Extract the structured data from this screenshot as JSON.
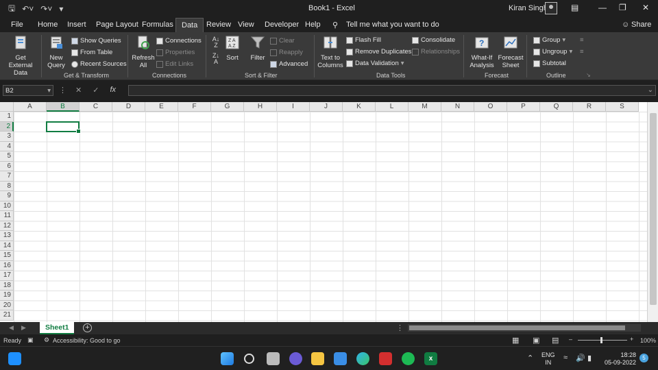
{
  "window": {
    "title": "Book1 - Excel",
    "user": "Kiran Singh"
  },
  "tabs": [
    {
      "label": "File"
    },
    {
      "label": "Home"
    },
    {
      "label": "Insert"
    },
    {
      "label": "Page Layout"
    },
    {
      "label": "Formulas"
    },
    {
      "label": "Data"
    },
    {
      "label": "Review"
    },
    {
      "label": "View"
    },
    {
      "label": "Developer"
    },
    {
      "label": "Help"
    }
  ],
  "tell_me": "Tell me what you want to do",
  "share": "Share",
  "ribbon": {
    "get_transform": {
      "label": "Get & Transform",
      "get_external_line1": "Get External",
      "get_external_line2": "Data",
      "new_query_line1": "New",
      "new_query_line2": "Query",
      "show_queries": "Show Queries",
      "from_table": "From Table",
      "recent_sources": "Recent Sources"
    },
    "connections": {
      "label": "Connections",
      "refresh_line1": "Refresh",
      "refresh_line2": "All",
      "connections": "Connections",
      "properties": "Properties",
      "edit_links": "Edit Links"
    },
    "sort_filter": {
      "label": "Sort & Filter",
      "sort": "Sort",
      "filter": "Filter",
      "clear": "Clear",
      "reapply": "Reapply",
      "advanced": "Advanced"
    },
    "data_tools": {
      "label": "Data Tools",
      "text_to_columns_line1": "Text to",
      "text_to_columns_line2": "Columns",
      "flash_fill": "Flash Fill",
      "remove_duplicates": "Remove Duplicates",
      "data_validation": "Data Validation",
      "consolidate": "Consolidate",
      "relationships": "Relationships"
    },
    "forecast": {
      "label": "Forecast",
      "whatif_line1": "What-If",
      "whatif_line2": "Analysis",
      "forecast_sheet_line1": "Forecast",
      "forecast_sheet_line2": "Sheet"
    },
    "outline": {
      "label": "Outline",
      "group": "Group",
      "ungroup": "Ungroup",
      "subtotal": "Subtotal"
    }
  },
  "formula_bar": {
    "name_box": "B2",
    "fx": "fx",
    "formula": ""
  },
  "grid": {
    "columns": [
      "A",
      "B",
      "C",
      "D",
      "E",
      "F",
      "G",
      "H",
      "I",
      "J",
      "K",
      "L",
      "M",
      "N",
      "O",
      "P",
      "Q",
      "R",
      "S"
    ],
    "rows": [
      "1",
      "2",
      "3",
      "4",
      "5",
      "6",
      "7",
      "8",
      "9",
      "10",
      "11",
      "12",
      "13",
      "14",
      "15",
      "16",
      "17",
      "18",
      "19",
      "20",
      "21"
    ],
    "selected_cell": "B2"
  },
  "sheets": [
    {
      "name": "Sheet1"
    }
  ],
  "status": {
    "ready": "Ready",
    "accessibility": "Accessibility: Good to go",
    "zoom": "100%"
  },
  "taskbar": {
    "lang_line1": "ENG",
    "lang_line2": "IN",
    "time": "18:28",
    "date": "05-09-2022",
    "notifications": "5"
  },
  "colors": {
    "excel_green": "#107c41",
    "ribbon_bg": "#3a3a3a",
    "title_bg": "#1f1f1f"
  }
}
